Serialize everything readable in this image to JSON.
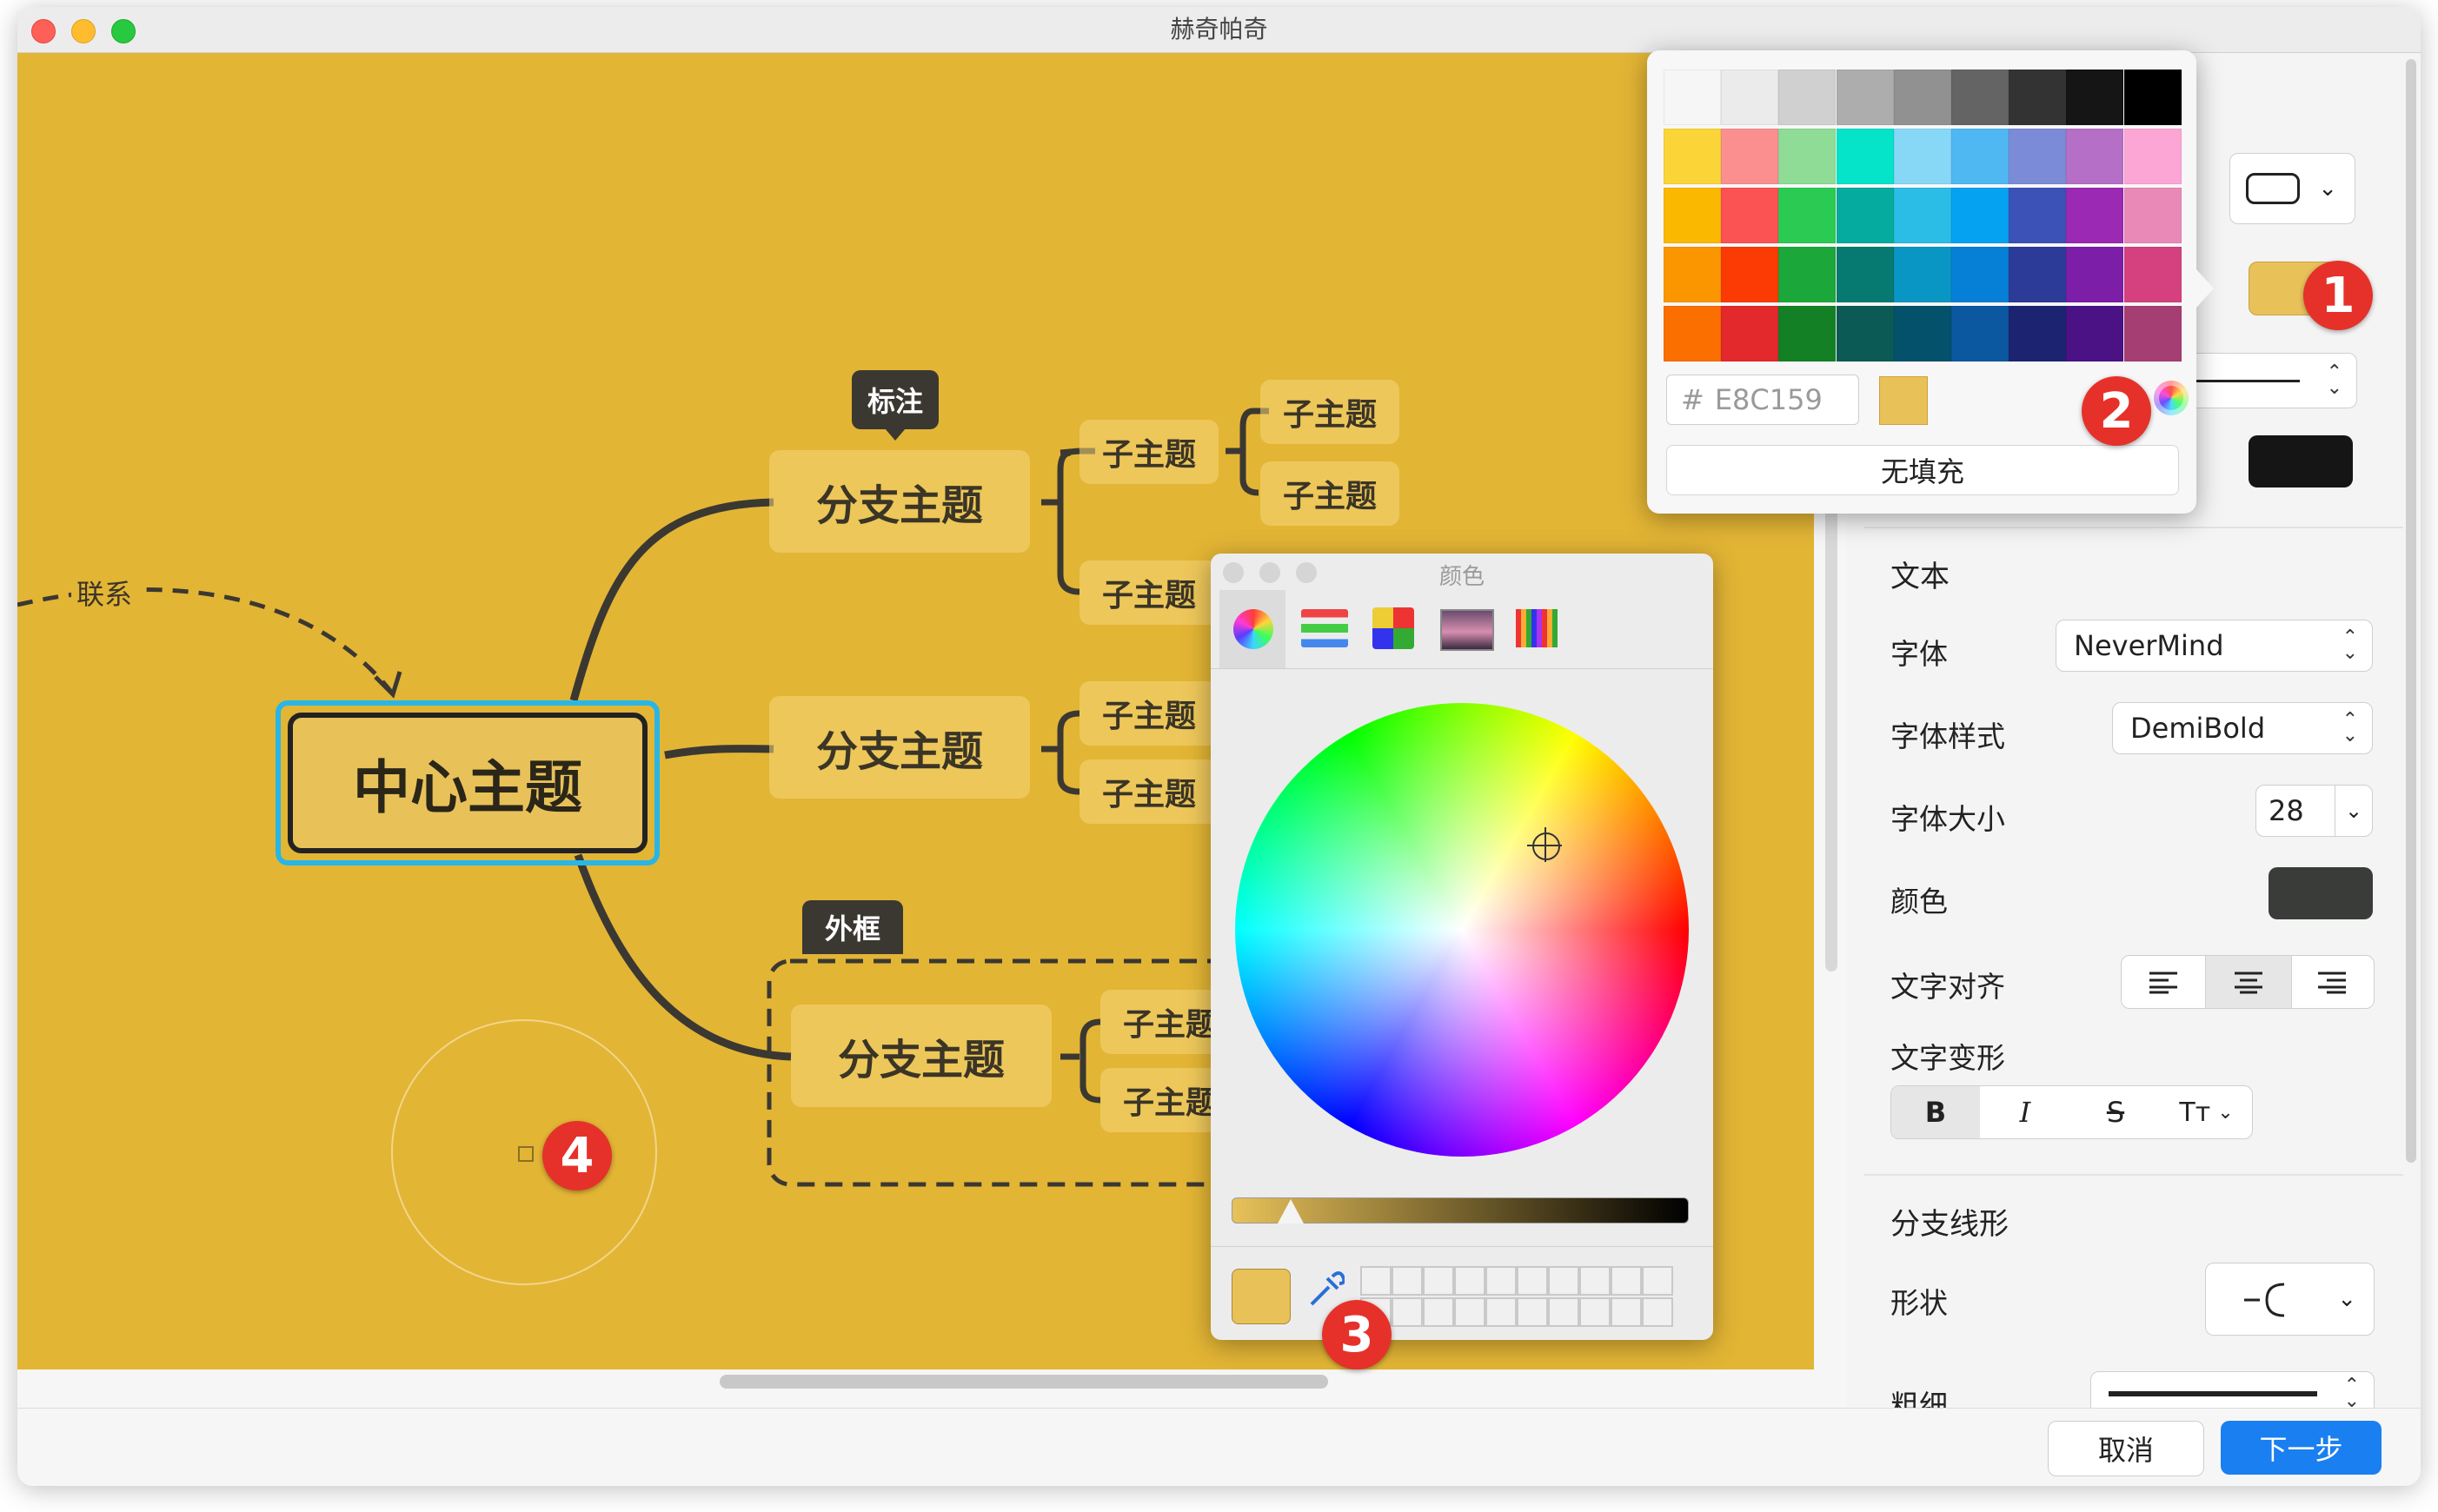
{
  "window": {
    "title": "赫奇帕奇"
  },
  "canvas": {
    "background": "#e3b535",
    "central_topic": "中心主题",
    "relation_label": "联系",
    "callout_label": "标注",
    "boundary_label": "外框",
    "branches": [
      {
        "label": "分支主题",
        "subs": [
          "子主题",
          "子主题",
          "子主题",
          "子主题"
        ]
      },
      {
        "label": "分支主题",
        "subs": [
          "子主题",
          "子主题"
        ]
      },
      {
        "label": "分支主题",
        "subs": [
          "子主题",
          "子主题"
        ]
      }
    ]
  },
  "color_popup": {
    "hex_prefix": "#",
    "hex_value": "E8C159",
    "no_fill_label": "无填充",
    "preview_color": "#e8c159",
    "grid_colors": [
      [
        "#f6f6f6",
        "#ebebeb",
        "#d0d0d0",
        "#adadad",
        "#919191",
        "#646464",
        "#333333",
        "#151515",
        "#000000"
      ],
      [
        "#fbd437",
        "#fb8f90",
        "#8edc96",
        "#05e3c9",
        "#87d8f7",
        "#4fb8f2",
        "#7c8bd7",
        "#b56fc6",
        "#fba6d4"
      ],
      [
        "#fbb800",
        "#fb5253",
        "#2bcb53",
        "#05ab9e",
        "#2bbde5",
        "#06a2f2",
        "#3c52b7",
        "#9b29b3",
        "#e989b8"
      ],
      [
        "#fb9600",
        "#fb3b03",
        "#1ca73a",
        "#067a70",
        "#0a96c5",
        "#0580d6",
        "#2d3b98",
        "#7c1ea7",
        "#d4417e"
      ],
      [
        "#fb6e00",
        "#e3292c",
        "#148025",
        "#0b5a55",
        "#04516c",
        "#0b58a0",
        "#1c2471",
        "#4b1286",
        "#a43e73"
      ]
    ]
  },
  "colors_window": {
    "title": "颜色",
    "current_color": "#e8c159",
    "toolbar_icons": [
      "color-wheel-icon",
      "color-sliders-icon",
      "color-palettes-icon",
      "image-palettes-icon",
      "pencils-icon"
    ]
  },
  "panel": {
    "text_header": "文本",
    "font_label": "字体",
    "font_value": "NeverMind",
    "font_style_label": "字体样式",
    "font_style_value": "DemiBold",
    "font_size_label": "字体大小",
    "font_size_value": "28",
    "color_label": "颜色",
    "text_color": "#3a3c39",
    "align_label": "文字对齐",
    "transform_label": "文字变形",
    "bold_label": "B",
    "italic_label": "I",
    "strike_label": "S",
    "case_label": "Tт",
    "branch_line_header": "分支线形",
    "shape_label": "形状",
    "thickness_label": "粗细",
    "fill_color": "#e8c159",
    "border_color": "#151515"
  },
  "footer": {
    "cancel_label": "取消",
    "next_label": "下一步",
    "next_color": "#1a7ff0"
  },
  "badges": [
    "1",
    "2",
    "3",
    "4"
  ]
}
